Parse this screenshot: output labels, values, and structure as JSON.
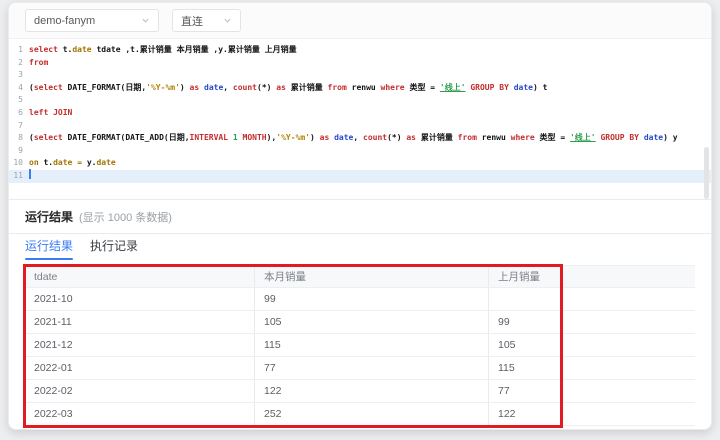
{
  "toolbar": {
    "datasource_select": "demo-fanym",
    "connection_select": "直连"
  },
  "editor": {
    "active_line": 11,
    "lines": [
      {
        "no": 1,
        "tokens": [
          [
            "select",
            "k"
          ],
          [
            " t.",
            "t"
          ],
          [
            "date",
            "p"
          ],
          [
            " tdate ,t.累计销量 本月销量 ,y.累计销量 上月销量",
            "t"
          ]
        ]
      },
      {
        "no": 2,
        "tokens": [
          [
            "from",
            "k"
          ]
        ]
      },
      {
        "no": 3,
        "tokens": []
      },
      {
        "no": 4,
        "tokens": [
          [
            "(",
            "t"
          ],
          [
            "select",
            "k"
          ],
          [
            " DATE_FORMAT(日期,",
            "t"
          ],
          [
            "'%Y-%m'",
            "s"
          ],
          [
            ") ",
            "t"
          ],
          [
            "as",
            "k"
          ],
          [
            " ",
            "t"
          ],
          [
            "date",
            "b"
          ],
          [
            ", ",
            "t"
          ],
          [
            "count",
            "k"
          ],
          [
            "(*) ",
            "t"
          ],
          [
            "as",
            "k"
          ],
          [
            " 累计销量 ",
            "t"
          ],
          [
            "from",
            "k"
          ],
          [
            " renwu ",
            "t"
          ],
          [
            "where",
            "k"
          ],
          [
            " 类型 = ",
            "t"
          ],
          [
            "'线上'",
            "g"
          ],
          [
            " ",
            "t"
          ],
          [
            "GROUP BY",
            "k"
          ],
          [
            " ",
            "t"
          ],
          [
            "date",
            "b"
          ],
          [
            ") t",
            "t"
          ]
        ]
      },
      {
        "no": 5,
        "tokens": []
      },
      {
        "no": 6,
        "tokens": [
          [
            "left JOIN",
            "k"
          ]
        ]
      },
      {
        "no": 7,
        "tokens": []
      },
      {
        "no": 8,
        "tokens": [
          [
            "(",
            "t"
          ],
          [
            "select",
            "k"
          ],
          [
            " DATE_FORMAT(DATE_ADD(日期,",
            "t"
          ],
          [
            "INTERVAL",
            "k"
          ],
          [
            " ",
            "t"
          ],
          [
            "1",
            "n"
          ],
          [
            " ",
            "t"
          ],
          [
            "MONTH",
            "k"
          ],
          [
            "),",
            "t"
          ],
          [
            "'%Y-%m'",
            "s"
          ],
          [
            ") ",
            "t"
          ],
          [
            "as",
            "k"
          ],
          [
            " ",
            "t"
          ],
          [
            "date",
            "b"
          ],
          [
            ", ",
            "t"
          ],
          [
            "count",
            "k"
          ],
          [
            "(*) ",
            "t"
          ],
          [
            "as",
            "k"
          ],
          [
            " 累计销量 ",
            "t"
          ],
          [
            "from",
            "k"
          ],
          [
            " renwu ",
            "t"
          ],
          [
            "where",
            "k"
          ],
          [
            " 类型 = ",
            "t"
          ],
          [
            "'线上'",
            "g"
          ],
          [
            " ",
            "t"
          ],
          [
            "GROUP BY",
            "k"
          ],
          [
            " ",
            "t"
          ],
          [
            "date",
            "b"
          ],
          [
            ") y",
            "t"
          ]
        ]
      },
      {
        "no": 9,
        "tokens": []
      },
      {
        "no": 10,
        "tokens": [
          [
            "on",
            "p"
          ],
          [
            " t.",
            "t"
          ],
          [
            "date",
            "p"
          ],
          [
            " ",
            "t"
          ],
          [
            "=",
            "p"
          ],
          [
            " y.",
            "t"
          ],
          [
            "date",
            "p"
          ]
        ]
      },
      {
        "no": 11,
        "tokens": []
      }
    ]
  },
  "results": {
    "title": "运行结果",
    "subtitle": "(显示 1000 条数据)",
    "tabs": [
      {
        "label": "运行结果",
        "active": true
      },
      {
        "label": "执行记录",
        "active": false
      }
    ]
  },
  "chart_data": {
    "type": "table",
    "columns": [
      "tdate",
      "本月销量",
      "上月销量"
    ],
    "rows": [
      [
        "2021-10",
        "99",
        ""
      ],
      [
        "2021-11",
        "105",
        "99"
      ],
      [
        "2021-12",
        "115",
        "105"
      ],
      [
        "2022-01",
        "77",
        "115"
      ],
      [
        "2022-02",
        "122",
        "77"
      ],
      [
        "2022-03",
        "252",
        "122"
      ]
    ]
  },
  "annotation": {
    "type": "highlight-box",
    "color": "#e11b22"
  },
  "colors": {
    "tab_active": "#3b7cf5",
    "keyword": "#c42d2d",
    "string": "#b08400",
    "string_green": "#2e9e4f",
    "builtin": "#2749c9",
    "active_line_bg": "#e4effb"
  }
}
